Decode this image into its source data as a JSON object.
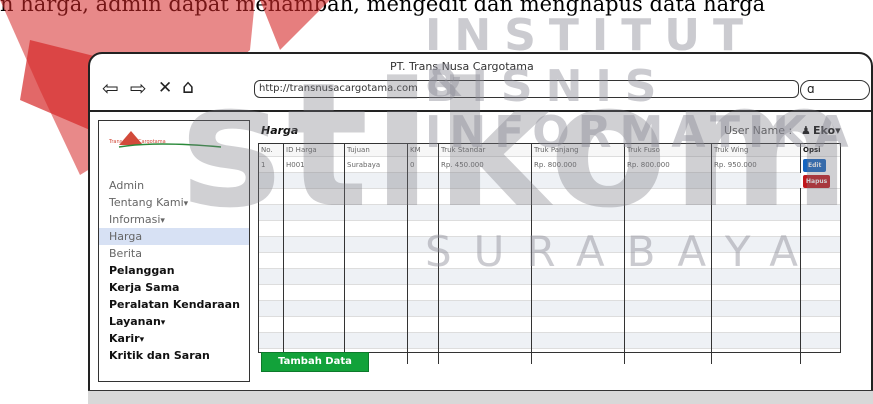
{
  "doc_text": {
    "line": "n harga, admin dapat menambah, mengedit dan menghapus data harga",
    "highlight": "a harga"
  },
  "watermark": {
    "top": "INSTITUT BISNIS",
    "mid": "& INFORMATIKA",
    "big": "stikom",
    "bottom": "SURABAYA"
  },
  "browser": {
    "title": "PT. Trans Nusa Cargotama",
    "url": "http://transnusacargotama.com"
  },
  "sidebar": {
    "logo_text": "Trans Nusa Cargotama",
    "items": [
      {
        "label": "Admin",
        "style": "normal"
      },
      {
        "label": "Tentang Kami",
        "style": "normal",
        "caret": "▾"
      },
      {
        "label": "Informasi",
        "style": "normal",
        "caret": "▾"
      },
      {
        "label": "Harga",
        "style": "active"
      },
      {
        "label": "Berita",
        "style": "normal"
      },
      {
        "label": "Pelanggan",
        "style": "bold"
      },
      {
        "label": "Kerja Sama",
        "style": "bold"
      },
      {
        "label": "Peralatan Kendaraan",
        "style": "bold"
      },
      {
        "label": "Layanan",
        "style": "bold",
        "caret": "▾"
      },
      {
        "label": "Karir",
        "style": "bold",
        "caret": "▾"
      },
      {
        "label": "Kritik dan Saran",
        "style": "bold"
      }
    ]
  },
  "content": {
    "title": "Harga",
    "user_label": "User Name :",
    "user_name": "Eko",
    "user_caret": "▾"
  },
  "table": {
    "headers": [
      "No.",
      "ID Harga",
      "Tujuan",
      "KM",
      "Truk Standar",
      "Truk Panjang",
      "Truk Fuso",
      "Truk Wing",
      "Opsi"
    ],
    "rows": [
      [
        "1",
        "H001",
        "Surabaya",
        "0",
        "Rp. 450.000",
        "Rp. 800.000",
        "Rp. 800.000",
        "Rp. 950.000"
      ]
    ],
    "edit_label": "Edit",
    "hapus_label": "Hapus"
  },
  "actions": {
    "tambah_label": "Tambah Data"
  },
  "colors": {
    "active_menu": "#d7e1f4",
    "edit_button": "#1565c0",
    "hapus_button": "#c0161b",
    "tambah_button": "#12a23a",
    "logo_red": "#d24a3a"
  }
}
